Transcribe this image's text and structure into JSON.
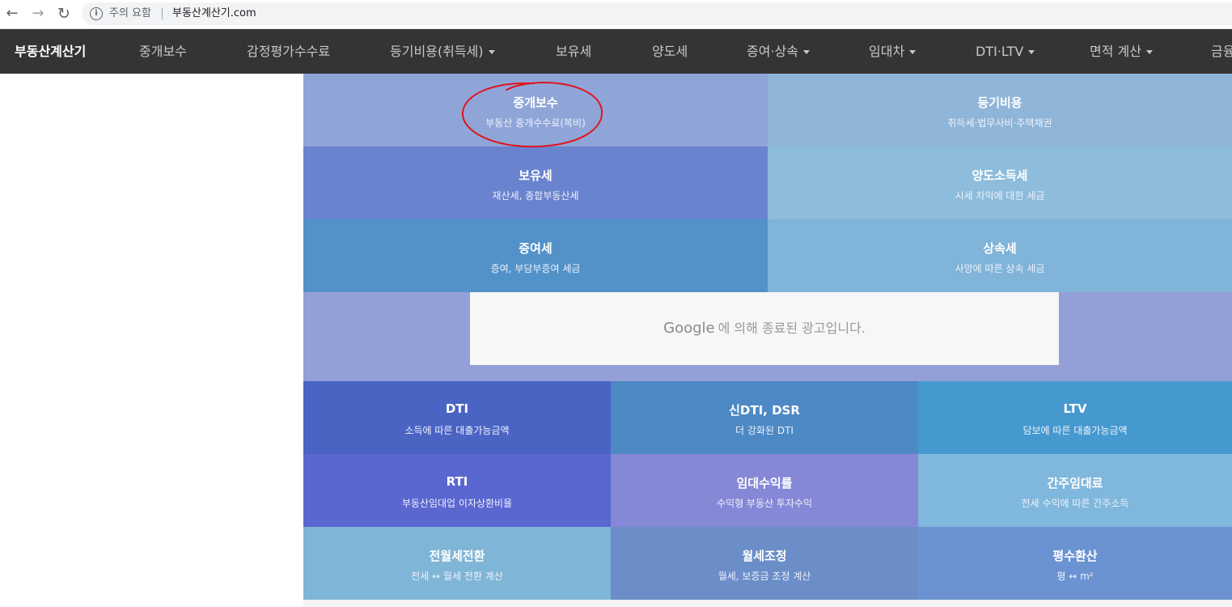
{
  "browser": {
    "security_label": "주의 요함",
    "url": "부동산계산기.com",
    "info_icon": "i"
  },
  "navbar": {
    "brand": "부동산계산기",
    "items": [
      {
        "label": "중개보수",
        "dropdown": false
      },
      {
        "label": "감정평가수수료",
        "dropdown": false
      },
      {
        "label": "등기비용(취득세)",
        "dropdown": true
      },
      {
        "label": "보유세",
        "dropdown": false
      },
      {
        "label": "양도세",
        "dropdown": false
      },
      {
        "label": "증여·상속",
        "dropdown": true
      },
      {
        "label": "임대차",
        "dropdown": true
      },
      {
        "label": "DTI·LTV",
        "dropdown": true
      },
      {
        "label": "면적 계산",
        "dropdown": true
      },
      {
        "label": "금융",
        "dropdown": false
      }
    ]
  },
  "tiles_top": [
    {
      "title": "중개보수",
      "subtitle": "부동산 중개수수료(복비)",
      "color": "#8fa5d8"
    },
    {
      "title": "등기비용",
      "subtitle": "취득세·법무사비·주택채권",
      "color": "#8fb5d8"
    },
    {
      "title": "보유세",
      "subtitle": "재산세, 종합부동산세",
      "color": "#6a83ce"
    },
    {
      "title": "양도소득세",
      "subtitle": "시세 차익에 대한 세금",
      "color": "#8ebcdc"
    },
    {
      "title": "증여세",
      "subtitle": "증여, 부담부증여 세금",
      "color": "#5392c9"
    },
    {
      "title": "상속세",
      "subtitle": "사망에 따른 상속 세금",
      "color": "#80b4d8"
    }
  ],
  "ad": {
    "google": "Google",
    "message": "에 의해 종료된 광고입니다."
  },
  "tiles_bottom": [
    {
      "title": "DTI",
      "subtitle": "소득에 따른 대출가능금액",
      "color": "#4a64c4"
    },
    {
      "title": "신DTI, DSR",
      "subtitle": "더 강화된 DTI",
      "color": "#4d89c4"
    },
    {
      "title": "LTV",
      "subtitle": "담보에 따른 대출가능금액",
      "color": "#4699cf"
    },
    {
      "title": "RTI",
      "subtitle": "부동산임대업 이자상환비율",
      "color": "#5a67d1"
    },
    {
      "title": "임대수익률",
      "subtitle": "수익형 부동산 투자수익",
      "color": "#8488d6"
    },
    {
      "title": "간주임대료",
      "subtitle": "전세 수익에 따른 간주소득",
      "color": "#80b7dc"
    },
    {
      "title": "전월세전환",
      "subtitle": "전세 ↔ 월세 전환 계산",
      "color": "#7fb5d6"
    },
    {
      "title": "월세조정",
      "subtitle": "월세, 보증금 조정 계산",
      "color": "#6b8dc8"
    },
    {
      "title": "평수환산",
      "subtitle": "평 ↔ m²",
      "color": "#6b93d2"
    }
  ]
}
